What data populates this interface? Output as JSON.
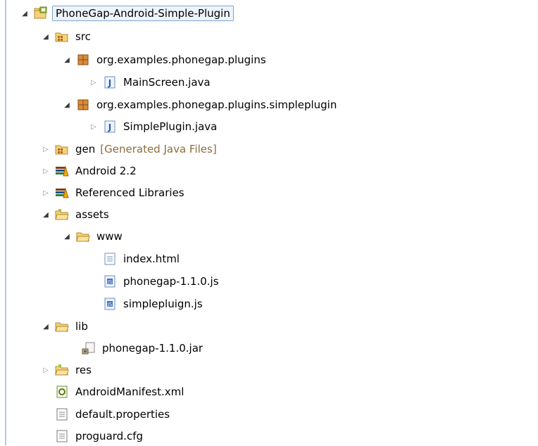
{
  "tree": {
    "root": {
      "label": "PhoneGap-Android-Simple-Plugin",
      "icon": "android-project-icon",
      "expanded": true
    },
    "src": {
      "label": "src",
      "icon": "source-folder-icon",
      "expanded": true
    },
    "pkg1": {
      "label": "org.examples.phonegap.plugins",
      "icon": "package-icon",
      "expanded": true
    },
    "mainscreen": {
      "label": "MainScreen.java",
      "icon": "java-file-icon",
      "expanded": false
    },
    "pkg2": {
      "label": "org.examples.phonegap.plugins.simpleplugin",
      "icon": "package-icon",
      "expanded": true
    },
    "simpleplugin": {
      "label": "SimplePlugin.java",
      "icon": "java-file-icon",
      "expanded": false
    },
    "gen": {
      "label": "gen",
      "decorator": "[Generated Java Files]",
      "icon": "source-folder-icon",
      "expanded": false
    },
    "android": {
      "label": "Android 2.2",
      "icon": "library-icon",
      "expanded": false
    },
    "reflibs": {
      "label": "Referenced Libraries",
      "icon": "library-icon",
      "expanded": false
    },
    "assets": {
      "label": "assets",
      "icon": "folder-icon",
      "expanded": true
    },
    "www": {
      "label": "www",
      "icon": "folder-icon",
      "expanded": true
    },
    "indexhtml": {
      "label": "index.html",
      "icon": "html-file-icon"
    },
    "phonegapjs": {
      "label": "phonegap-1.1.0.js",
      "icon": "js-file-icon"
    },
    "simplepluginjs": {
      "label": "simplepluign.js",
      "icon": "js-file-icon"
    },
    "lib": {
      "label": "lib",
      "icon": "folder-icon",
      "expanded": true
    },
    "phonegapjar": {
      "label": "phonegap-1.1.0.jar",
      "icon": "jar-file-icon"
    },
    "res": {
      "label": "res",
      "icon": "folder-icon",
      "expanded": false
    },
    "manifest": {
      "label": "AndroidManifest.xml",
      "icon": "manifest-file-icon"
    },
    "defaultprops": {
      "label": "default.properties",
      "icon": "text-file-icon"
    },
    "proguard": {
      "label": "proguard.cfg",
      "icon": "text-file-icon"
    }
  },
  "colors": {
    "selection_border": "#7da2ce",
    "selection_fill": "#eef4fb",
    "decorator_text": "#8a6d3b",
    "folder": "#e8b84a",
    "package": "#b5651d",
    "java": "#2a5db0"
  }
}
